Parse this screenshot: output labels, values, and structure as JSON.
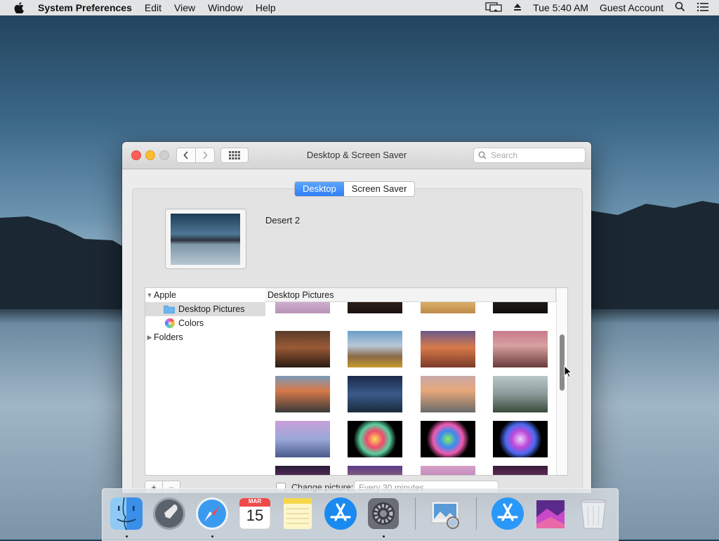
{
  "menubar": {
    "app_name": "System Preferences",
    "menus": [
      "Edit",
      "View",
      "Window",
      "Help"
    ],
    "clock": "Tue 5:40 AM",
    "user": "Guest Account"
  },
  "window": {
    "title": "Desktop & Screen Saver",
    "search_placeholder": "Search",
    "tabs": [
      {
        "label": "Desktop",
        "active": true
      },
      {
        "label": "Screen Saver",
        "active": false
      }
    ],
    "current_picture": "Desert 2",
    "sidebar": {
      "group": "Apple",
      "items": [
        "Desktop Pictures",
        "Colors"
      ],
      "folders": "Folders"
    },
    "grid_header": "Desktop Pictures",
    "plus": "+",
    "minus": "−",
    "change_picture_label": "Change picture:",
    "interval": "Every 30 minutes"
  },
  "dock": {
    "calendar_month": "MAR",
    "calendar_day": "15",
    "apps": [
      "finder-icon",
      "launchpad-icon",
      "safari-icon",
      "calendar-icon",
      "notes-icon",
      "app-store-icon",
      "system-preferences-icon",
      "preview-icon",
      "app-store-downloads-icon",
      "wallpaper-folder-icon",
      "trash-icon"
    ]
  },
  "colors": {
    "accent": "#2e7ef6",
    "close": "#fc5f57",
    "minimize": "#fdbc2e"
  }
}
